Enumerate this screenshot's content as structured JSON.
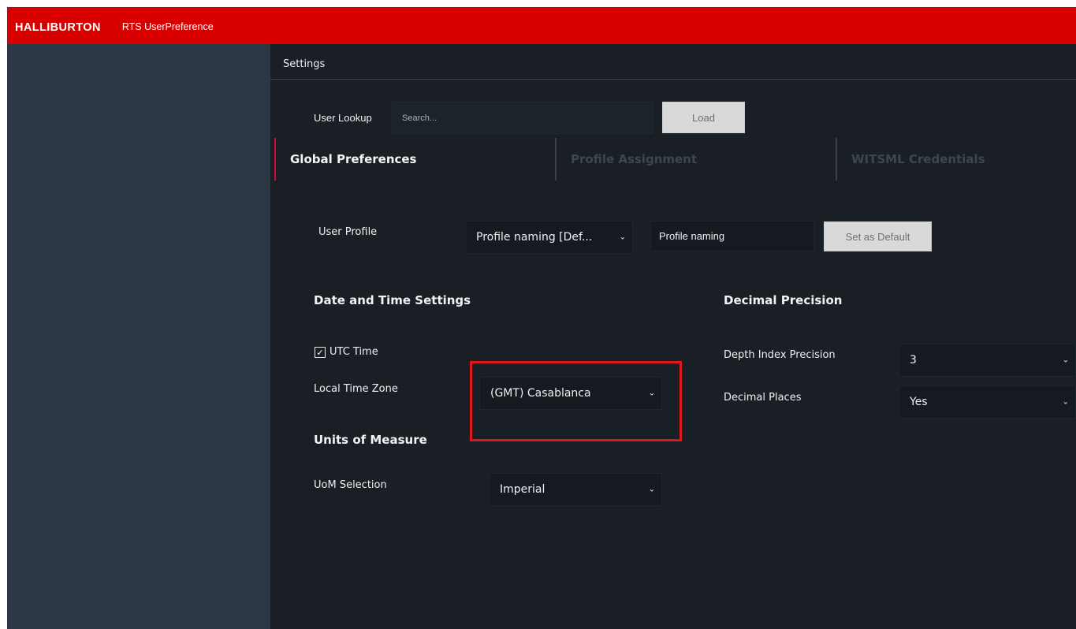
{
  "header": {
    "brand": "HALLIBURTON",
    "app_title": "RTS UserPreference"
  },
  "page": {
    "title": "Settings"
  },
  "user_lookup": {
    "label": "User Lookup",
    "placeholder": "Search...",
    "load_label": "Load"
  },
  "tabs": [
    {
      "label": "Global Preferences",
      "active": true
    },
    {
      "label": "Profile Assignment",
      "active": false
    },
    {
      "label": "WITSML Credentials",
      "active": false
    }
  ],
  "user_profile": {
    "label": "User Profile",
    "selected": "Profile naming [Def...",
    "name_value": "Profile naming",
    "set_default_label": "Set as Default"
  },
  "date_time": {
    "heading": "Date and Time Settings",
    "utc_label": "UTC Time",
    "utc_checked": true,
    "timezone_label": "Local Time Zone",
    "timezone_value": "(GMT) Casablanca"
  },
  "units": {
    "heading": "Units of Measure",
    "uom_label": "UoM Selection",
    "uom_value": "Imperial"
  },
  "decimal": {
    "heading": "Decimal Precision",
    "depth_label": "Depth Index Precision",
    "depth_value": "3",
    "places_label": "Decimal Places",
    "places_value": "Yes"
  },
  "colors": {
    "topbar": "#d90000",
    "sidebar": "#2b3745",
    "main_bg": "#1a1f25",
    "highlight": "#e0181e",
    "active_tab_accent": "#c8102e"
  }
}
